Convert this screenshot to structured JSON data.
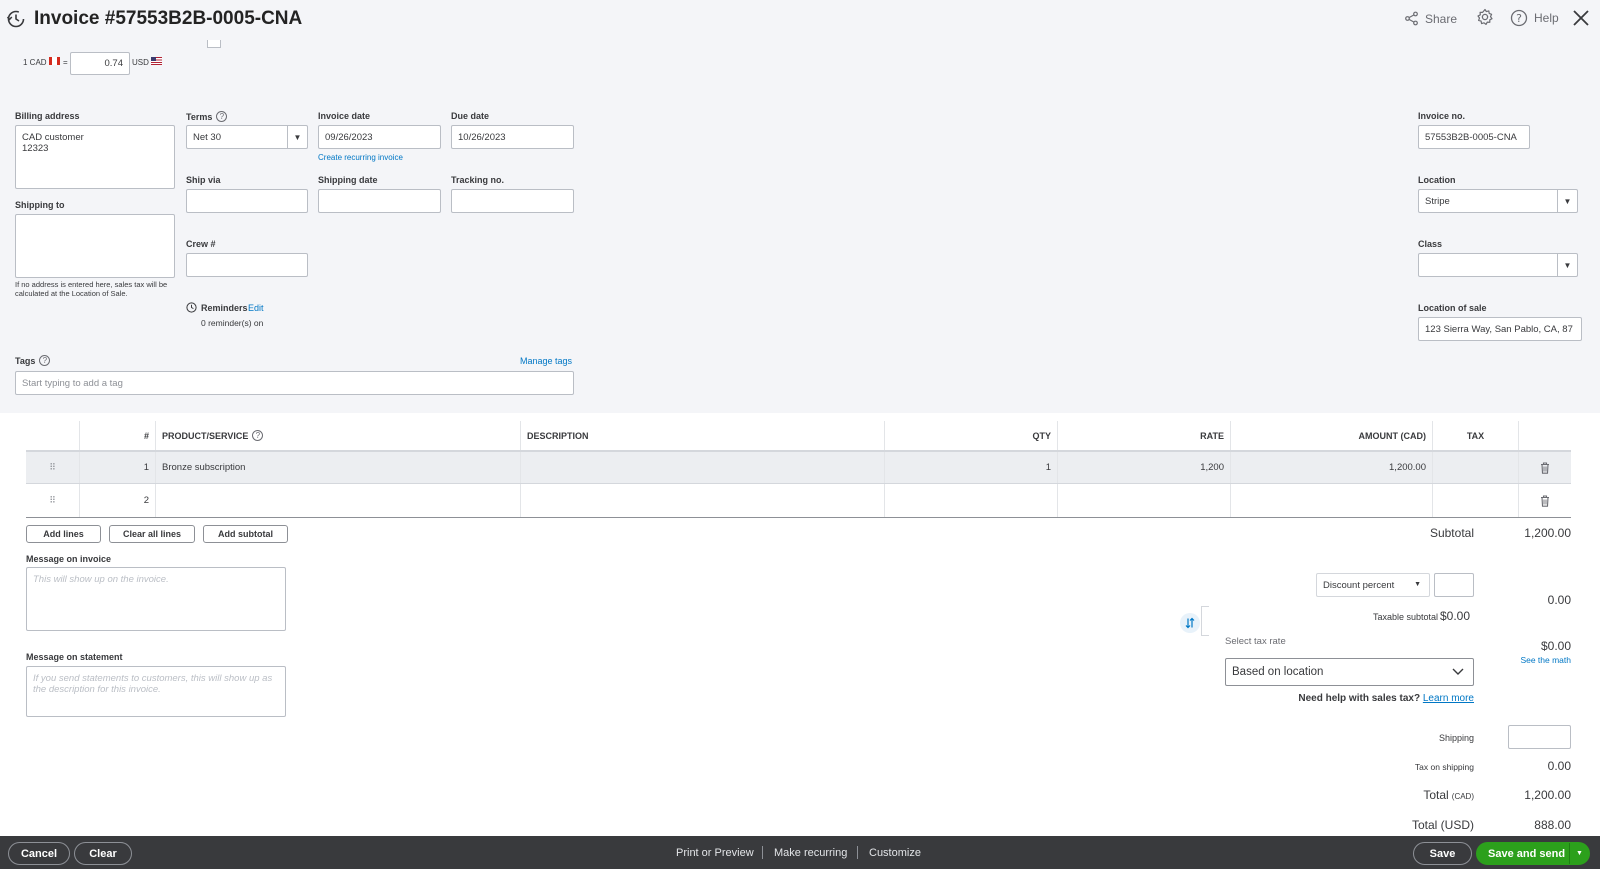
{
  "header": {
    "title": "Invoice #57553B2B-0005-CNA",
    "share_label": "Share",
    "help_label": "Help"
  },
  "currency": {
    "from_label": "1 CAD",
    "rate": "0.74",
    "to_label": "USD"
  },
  "billing": {
    "billing_address_label": "Billing address",
    "billing_address_value": "CAD customer\n  12323",
    "shipping_to_label": "Shipping to",
    "shipping_note": "If no address is entered here, sales tax will be calculated at the Location of Sale."
  },
  "terms": {
    "label": "Terms",
    "value": "Net 30"
  },
  "invoice_date": {
    "label": "Invoice date",
    "value": "09/26/2023"
  },
  "due_date": {
    "label": "Due date",
    "value": "10/26/2023"
  },
  "create_recurring": "Create recurring invoice",
  "ship_via": {
    "label": "Ship via",
    "value": ""
  },
  "shipping_date": {
    "label": "Shipping date",
    "value": ""
  },
  "tracking_no": {
    "label": "Tracking no.",
    "value": ""
  },
  "crew": {
    "label": "Crew #",
    "value": ""
  },
  "reminders": {
    "label": "Reminders",
    "edit": "Edit",
    "status": "0 reminder(s) on"
  },
  "tags": {
    "label": "Tags",
    "manage": "Manage tags",
    "placeholder": "Start typing to add a tag"
  },
  "right_panel": {
    "invoice_no_label": "Invoice no.",
    "invoice_no_value": "57553B2B-0005-CNA",
    "location_label": "Location",
    "location_value": "Stripe",
    "class_label": "Class",
    "class_value": "",
    "location_of_sale_label": "Location of sale",
    "location_of_sale_value": "123 Sierra Way, San Pablo, CA, 87"
  },
  "table": {
    "headers": {
      "num": "#",
      "product": "PRODUCT/SERVICE",
      "description": "DESCRIPTION",
      "qty": "QTY",
      "rate": "RATE",
      "amount": "AMOUNT (CAD)",
      "tax": "TAX"
    },
    "rows": [
      {
        "num": "1",
        "product": "Bronze subscription",
        "description": "",
        "qty": "1",
        "rate": "1,200",
        "amount": "1,200.00",
        "tax": ""
      },
      {
        "num": "2",
        "product": "",
        "description": "",
        "qty": "",
        "rate": "",
        "amount": "",
        "tax": ""
      }
    ]
  },
  "line_buttons": {
    "add_lines": "Add lines",
    "clear_all": "Clear all lines",
    "add_subtotal": "Add subtotal"
  },
  "messages": {
    "invoice_label": "Message on invoice",
    "invoice_placeholder": "This will show up on the invoice.",
    "statement_label": "Message on statement",
    "statement_placeholder": "If you send statements to customers, this will show up as the description for this invoice."
  },
  "totals": {
    "subtotal_label": "Subtotal",
    "subtotal_value": "1,200.00",
    "discount_type": "Discount percent",
    "discount_input": "",
    "discount_value": "0.00",
    "taxable_subtotal_label": "Taxable subtotal",
    "taxable_subtotal_value": "$0.00",
    "select_tax_rate_label": "Select tax rate",
    "tax_rate_value": "Based on location",
    "tax_value": "$0.00",
    "see_math": "See the math",
    "help_text": "Need help with sales tax?",
    "learn_more": "Learn more",
    "shipping_label": "Shipping",
    "shipping_input": "",
    "tax_on_shipping_label": "Tax on shipping",
    "tax_on_shipping_value": "0.00",
    "total_label": "Total",
    "total_currency": "(CAD)",
    "total_value": "1,200.00",
    "total_usd_label": "Total (USD)",
    "total_usd_value": "888.00"
  },
  "footer": {
    "cancel": "Cancel",
    "clear": "Clear",
    "print_preview": "Print or Preview",
    "make_recurring": "Make recurring",
    "customize": "Customize",
    "save": "Save",
    "save_and_send": "Save and send"
  },
  "colors": {
    "accent_green": "#2ca01c",
    "link_blue": "#0077c5",
    "footer_dark": "#393a3d",
    "panel_bg": "#f4f5f8"
  }
}
